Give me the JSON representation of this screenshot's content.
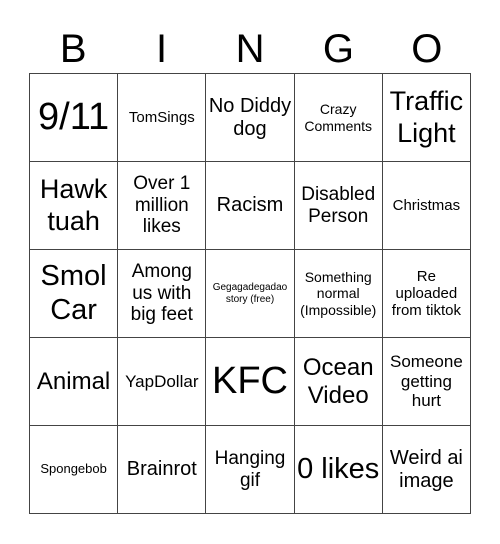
{
  "header": [
    "B",
    "I",
    "N",
    "G",
    "O"
  ],
  "cells": [
    "9/11",
    "TomSings",
    "No Diddy dog",
    "Crazy Comments",
    "Traffic Light",
    "Hawk tuah",
    "Over 1 million likes",
    "Racism",
    "Disabled Person",
    "Christmas",
    "Smol Car",
    "Among us with big feet",
    "Gegagadegadao story (free)",
    "Something normal (Impossible)",
    "Re uploaded from tiktok",
    "Animal",
    "YapDollar",
    "KFC",
    "Ocean Video",
    "Someone getting hurt",
    "Spongebob",
    "Brainrot",
    "Hanging gif",
    "0 likes",
    "Weird ai image"
  ]
}
